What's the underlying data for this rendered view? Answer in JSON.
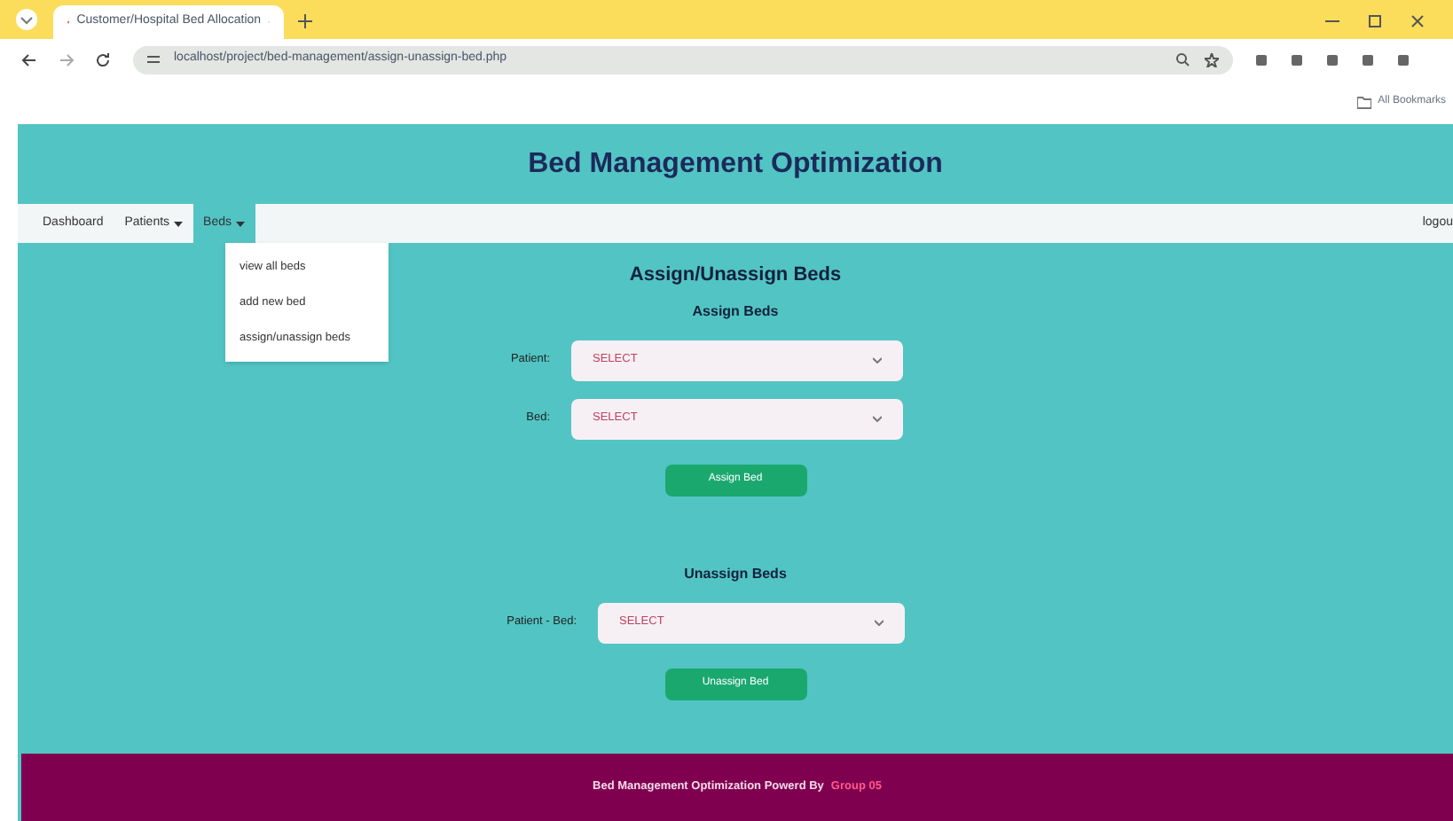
{
  "browser": {
    "tab_title": "Customer/Hospital Bed Allocation",
    "url": "localhost/project/bed-management/assign-unassign-bed.php",
    "bookmarks_label": "All Bookmarks"
  },
  "header": {
    "title": "Bed Management Optimization"
  },
  "navbar": {
    "items": [
      {
        "label": "Dashboard",
        "dropdown": false,
        "selected": false
      },
      {
        "label": "Patients",
        "dropdown": true,
        "selected": false
      },
      {
        "label": "Beds",
        "dropdown": true,
        "selected": true
      }
    ],
    "right_link": "logou"
  },
  "menu": {
    "items": [
      "view all beds",
      "add new bed",
      "assign/unassign beds"
    ]
  },
  "page_title": "Assign/Unassign Beds",
  "assign": {
    "heading": "Assign Beds",
    "fields": [
      {
        "label": "Patient:",
        "value": "SELECT"
      },
      {
        "label": "Bed:",
        "value": "SELECT"
      }
    ],
    "button": "Assign Bed"
  },
  "unassign": {
    "heading": "Unassign Beds",
    "fields": [
      {
        "label": "Patient - Bed:",
        "value": "SELECT"
      }
    ],
    "button": "Unassign Bed"
  },
  "footer": {
    "text": "Bed Management Optimization Powerd By",
    "highlight": "Group 05"
  }
}
